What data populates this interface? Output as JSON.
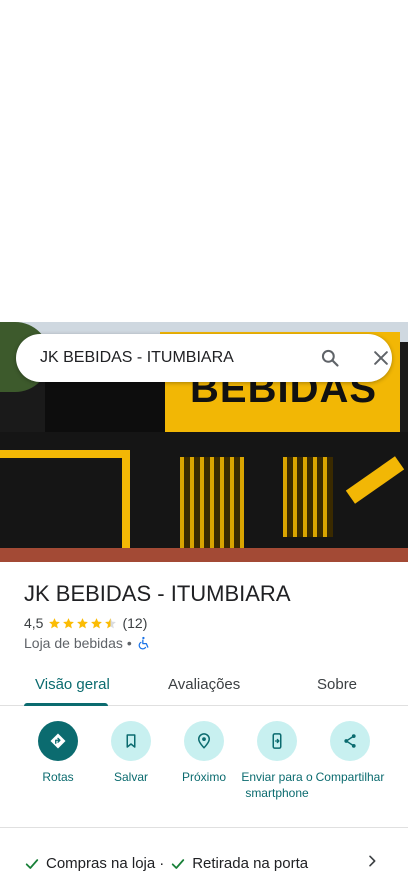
{
  "search": {
    "query": "JK BEBIDAS - ITUMBIARA",
    "search_icon": "search-icon",
    "close_icon": "close-icon"
  },
  "hero": {
    "sign_text": "BEBIDAS"
  },
  "place": {
    "name": "JK BEBIDAS - ITUMBIARA",
    "rating": "4,5",
    "rating_value": 4.5,
    "review_count": "(12)",
    "category": "Loja de bebidas",
    "separator": "•"
  },
  "tabs": [
    {
      "label": "Visão geral",
      "active": true
    },
    {
      "label": "Avaliações",
      "active": false
    },
    {
      "label": "Sobre",
      "active": false
    }
  ],
  "actions": [
    {
      "label": "Rotas",
      "icon": "directions-icon"
    },
    {
      "label": "Salvar",
      "icon": "bookmark-icon"
    },
    {
      "label": "Próximo",
      "icon": "nearby-icon"
    },
    {
      "label": "Enviar para o smartphone",
      "icon": "send-to-phone-icon"
    },
    {
      "label": "Compartilhar",
      "icon": "share-icon"
    }
  ],
  "services": {
    "item1": "Compras na loja",
    "dot": "·",
    "item2": "Retirada na porta"
  },
  "colors": {
    "accent": "#0b6b6f",
    "accent_light": "#c8f0f0",
    "star": "#fbbc04",
    "check": "#188038"
  }
}
